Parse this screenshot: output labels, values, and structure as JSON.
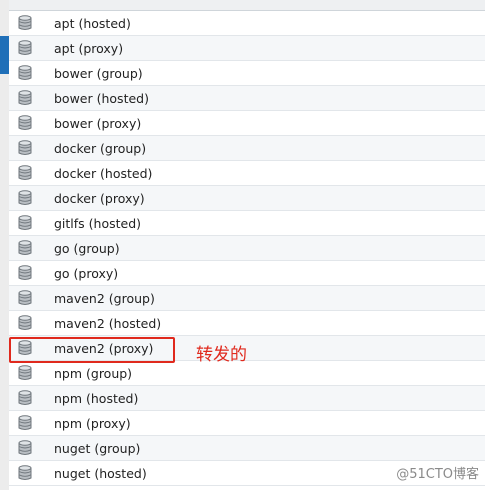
{
  "repositories": [
    {
      "name": "apt (hosted)"
    },
    {
      "name": "apt (proxy)"
    },
    {
      "name": "bower (group)"
    },
    {
      "name": "bower (hosted)"
    },
    {
      "name": "bower (proxy)"
    },
    {
      "name": "docker (group)"
    },
    {
      "name": "docker (hosted)"
    },
    {
      "name": "docker (proxy)"
    },
    {
      "name": "gitlfs (hosted)"
    },
    {
      "name": "go (group)"
    },
    {
      "name": "go (proxy)"
    },
    {
      "name": "maven2 (group)"
    },
    {
      "name": "maven2 (hosted)"
    },
    {
      "name": "maven2 (proxy)"
    },
    {
      "name": "npm (group)"
    },
    {
      "name": "npm (hosted)"
    },
    {
      "name": "npm (proxy)"
    },
    {
      "name": "nuget (group)"
    },
    {
      "name": "nuget (hosted)"
    }
  ],
  "row_icon": "database-icon",
  "annotation": {
    "text": "转发的",
    "color": "#e0291d"
  },
  "watermark": "@51CTO博客",
  "colors": {
    "accent": "#1f6fb8",
    "highlight": "#e0291d"
  }
}
